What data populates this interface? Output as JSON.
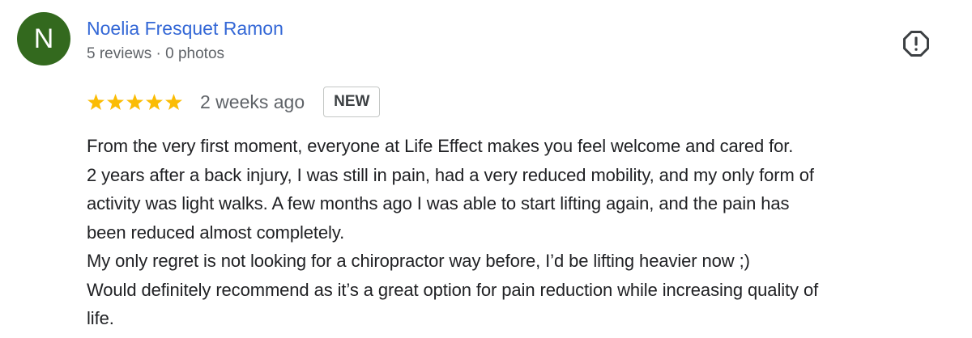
{
  "review": {
    "avatar_letter": "N",
    "avatar_color": "#33691e",
    "reviewer_name": "Noelia Fresquet Ramon",
    "reviewer_meta": "5 reviews · 0 photos",
    "rating": 5,
    "rating_max": 5,
    "star_color": "#fbbc04",
    "date": "2 weeks ago",
    "badge": "NEW",
    "report_icon": "report-flag-exclamation-icon",
    "lines": [
      "From the very first moment, everyone at Life Effect makes you feel welcome and cared for.",
      "2 years after a back injury, I was still in pain, had a very reduced mobility, and my only form of",
      "activity was light walks. A few months ago I was able to start lifting again, and the pain has",
      "been reduced almost completely.",
      "My only regret is not looking for a chiropractor way before, I’d be lifting heavier now ;)",
      "Would definitely recommend as it’s a great option for pain reduction while increasing quality of",
      "life."
    ]
  }
}
